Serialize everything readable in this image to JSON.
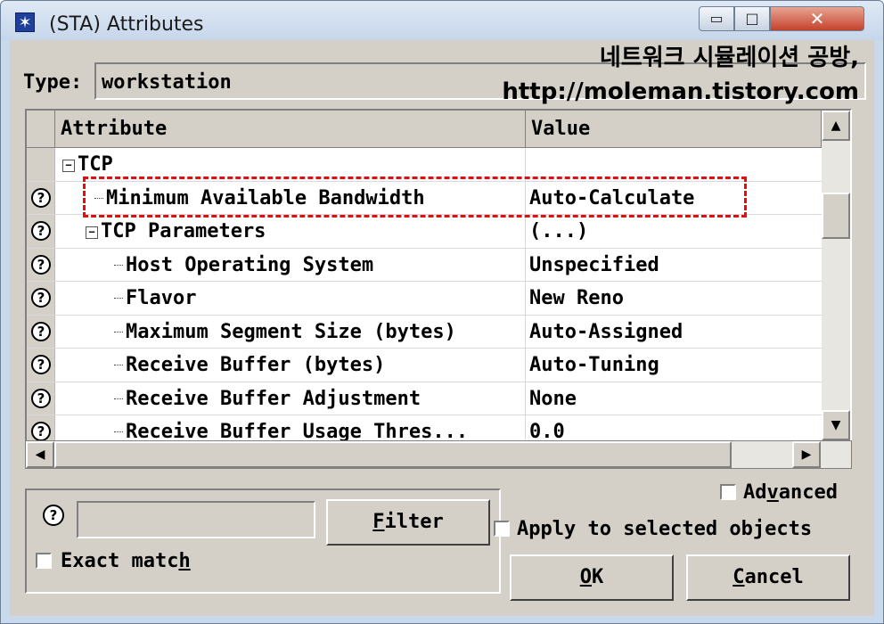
{
  "window": {
    "title": "(STA) Attributes",
    "min_glyph": "▭",
    "max_glyph": "□",
    "close_glyph": "✕",
    "icon_glyph": "✶"
  },
  "watermark": {
    "line1": "네트워크 시뮬레이션 공방,",
    "line2": "http://moleman.tistory.com"
  },
  "type": {
    "label": "Type:",
    "value": "workstation"
  },
  "table": {
    "headers": {
      "attribute": "Attribute",
      "value": "Value"
    },
    "rows": [
      {
        "help": "",
        "toggle": "⊟",
        "label": "TCP",
        "value": ""
      },
      {
        "help": "?",
        "label": "Minimum Available Bandwidth",
        "value": "Auto-Calculate"
      },
      {
        "help": "?",
        "toggle": "⊟",
        "label": "TCP Parameters",
        "value": "(...)"
      },
      {
        "help": "?",
        "label": "Host Operating System",
        "value": "Unspecified"
      },
      {
        "help": "?",
        "label": "Flavor",
        "value": "New Reno"
      },
      {
        "help": "?",
        "label": "Maximum Segment Size (bytes)",
        "value": "Auto-Assigned"
      },
      {
        "help": "?",
        "label": "Receive Buffer (bytes)",
        "value": "Auto-Tuning"
      },
      {
        "help": "?",
        "label": "Receive Buffer Adjustment",
        "value": "None"
      },
      {
        "help": "?",
        "label": "Receive Buffer Usage Thres...",
        "value": "0.0"
      }
    ]
  },
  "scroll": {
    "up": "▲",
    "down": "▼",
    "left": "◀",
    "right": "▶"
  },
  "filter": {
    "help": "?",
    "input_value": "",
    "button_prefix": "",
    "button_underlined": "F",
    "button_rest": "ilter",
    "exact_match_label": "Exact matc",
    "exact_match_underlined": "h"
  },
  "options": {
    "advanced_prefix": "Ad",
    "advanced_underlined": "v",
    "advanced_rest": "anced",
    "apply_label": "Apply to selected objects"
  },
  "buttons": {
    "ok_underlined": "O",
    "ok_rest": "K",
    "cancel_underlined": "C",
    "cancel_rest": "ancel"
  },
  "colors": {
    "highlight_box": "#e01010",
    "title_bar": "#c6d6ea",
    "dialog_bg": "#d4d0c8"
  }
}
